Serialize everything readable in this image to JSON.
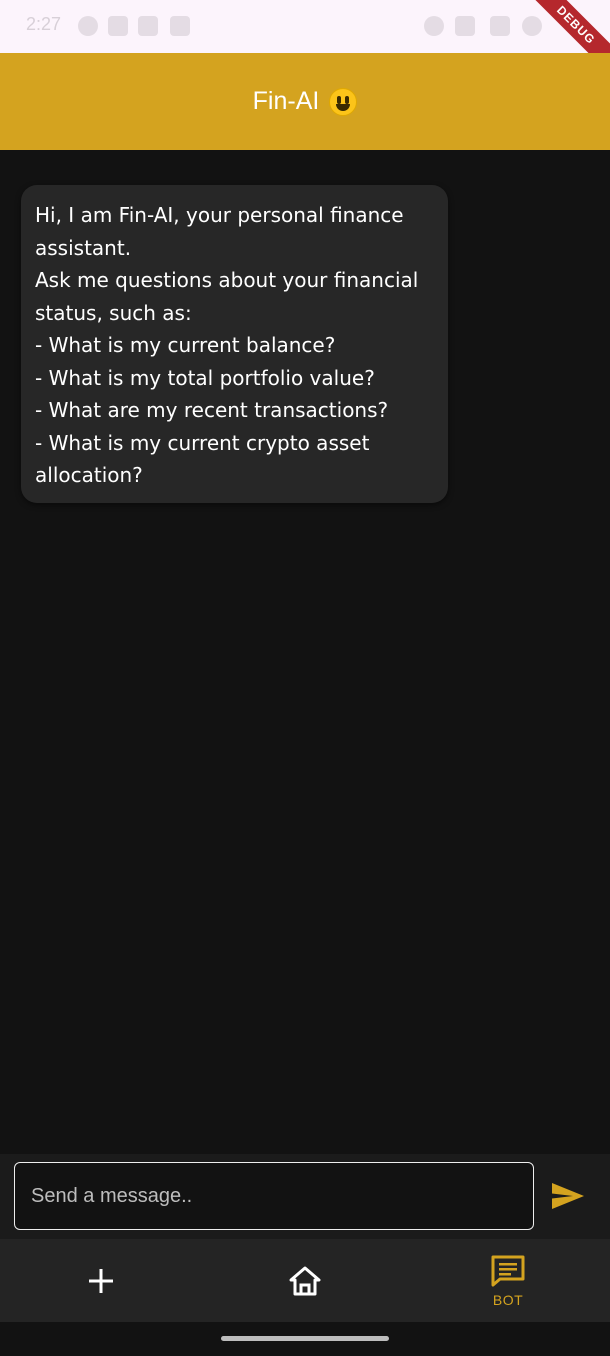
{
  "status_bar": {
    "time": "2:27"
  },
  "debug_banner": {
    "label": "DEBUG"
  },
  "app_bar": {
    "title": "Fin-AI",
    "emoji_icon": "smiling-face-icon"
  },
  "chat": {
    "messages": [
      {
        "sender": "bot",
        "lines": [
          "Hi, I am Fin-AI, your personal finance",
          "assistant.",
          "Ask me questions about your financial",
          "status, such as:",
          "- What is my current balance?",
          "- What is my total portfolio value?",
          "- What are my recent transactions?",
          "- What is my current crypto asset",
          "allocation?"
        ]
      }
    ]
  },
  "composer": {
    "placeholder": "Send a message..",
    "value": "",
    "send_icon": "send-icon"
  },
  "bottom_nav": {
    "items": [
      {
        "icon": "plus-icon",
        "label": "",
        "active": false
      },
      {
        "icon": "home-icon",
        "label": "",
        "active": false
      },
      {
        "icon": "chat-icon",
        "label": "BOT",
        "active": true
      }
    ]
  },
  "colors": {
    "accent": "#d4a31f",
    "background": "#121212",
    "bubble": "#272727",
    "nav_background": "#242424"
  }
}
